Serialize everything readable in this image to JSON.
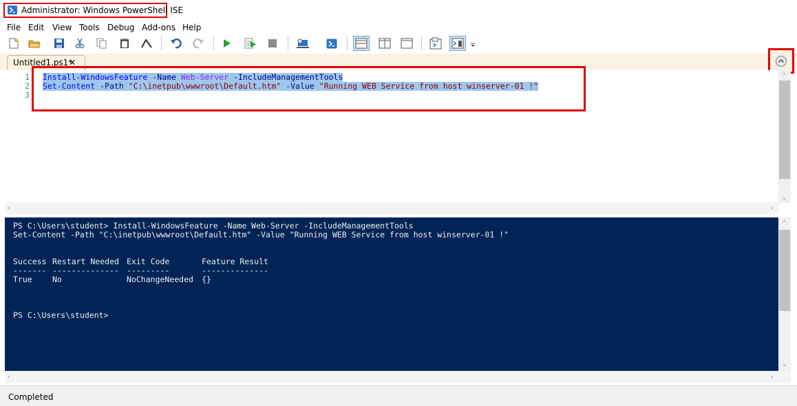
{
  "window": {
    "title": "Administrator: Windows PowerShell ISE"
  },
  "menu": [
    "File",
    "Edit",
    "View",
    "Tools",
    "Debug",
    "Add-ons",
    "Help"
  ],
  "toolbar": {
    "icons": [
      "new-file-icon",
      "open-folder-icon",
      "save-icon",
      "cut-icon",
      "copy-icon",
      "paste-icon",
      "clear-icon",
      "undo-icon",
      "redo-icon",
      "run-script-icon",
      "run-selection-icon",
      "stop-icon",
      "remote-powershell-icon",
      "powershell-console-icon",
      "show-script-pane-top-icon",
      "show-script-pane-right-icon",
      "show-script-pane-maximized-icon",
      "show-command-window-icon",
      "show-command-addon-icon",
      "customize-toolbar-icon"
    ]
  },
  "tab": {
    "label": "Untitled1.ps1*",
    "close": "✕"
  },
  "editor": {
    "lines": [
      {
        "no": "1",
        "cmd": "Install-WindowsFeature",
        "p1": "-Name",
        "arg": "Web-Server",
        "p2": "-IncludeManagementTools"
      },
      {
        "no": "2",
        "cmd": "Set-Content",
        "p1": "-Path",
        "s1": "\"C:\\inetpub\\wwwroot\\Default.htm\"",
        "p2": "-Value",
        "s2": "\"Running WEB Service from host winserver-01 !\""
      },
      {
        "no": "3"
      }
    ]
  },
  "console": {
    "prompt_cmd": "PS C:\\Users\\student> Install-WindowsFeature -Name Web-Server -IncludeManagementTools",
    "cmd2": "Set-Content -Path \"C:\\inetpub\\wwwroot\\Default.htm\" -Value \"Running WEB Service from host winserver-01 !\"",
    "headers": [
      "Success",
      "Restart Needed",
      "Exit Code",
      "Feature Result"
    ],
    "underlines": [
      "-------",
      "--------------",
      "---------",
      "--------------"
    ],
    "row": [
      "True",
      "No",
      "NoChangeNeeded",
      "{}"
    ],
    "prompt": "PS C:\\Users\\student>"
  },
  "status": {
    "text": "Completed"
  },
  "colors": {
    "console_bg": "#012456",
    "selection": "#9fc7ec",
    "highlight_box": "#e00000"
  }
}
